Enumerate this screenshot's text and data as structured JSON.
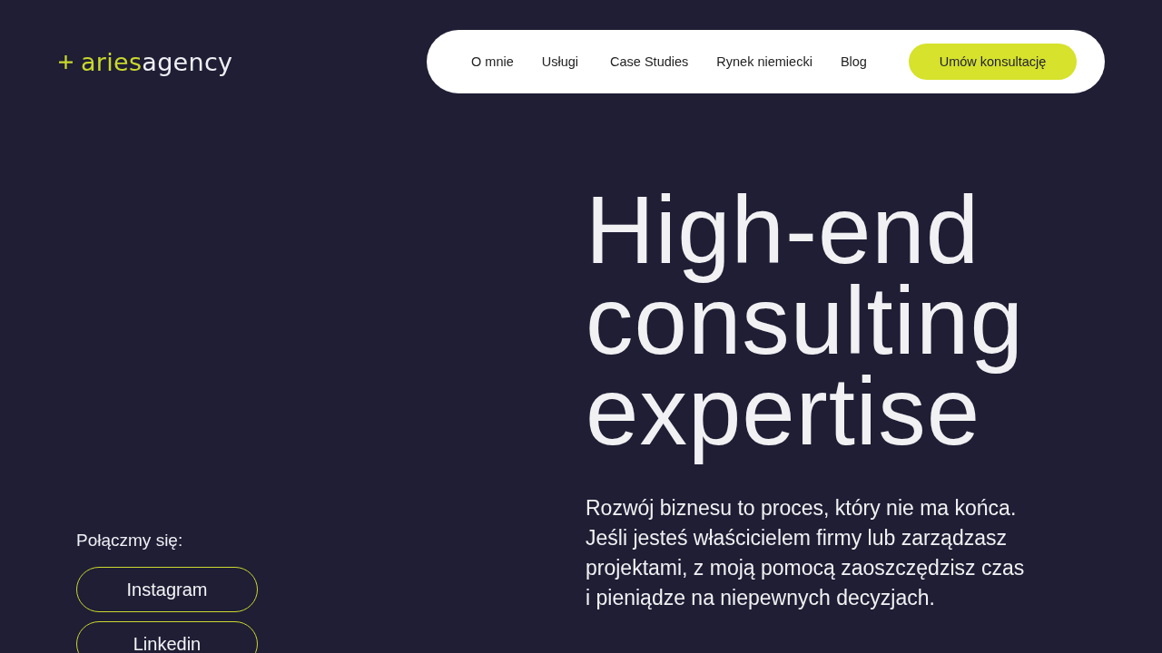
{
  "header": {
    "logo": {
      "primary": "aries",
      "secondary": "agency"
    },
    "nav": {
      "items": [
        "O mnie",
        "Usługi",
        "Case Studies",
        "Rynek niemiecki",
        "Blog"
      ],
      "cta": "Umów konsultację"
    }
  },
  "hero": {
    "heading": "High-end consulting expertise",
    "paragraph": "Rozwój biznesu to proces, który nie ma końca.\nJeśli jesteś właścicielem firmy lub zarządzasz\nprojektami, z moją pomocą zaoszczędzisz czas\ni pieniądze na niepewnych decyzjach."
  },
  "contact": {
    "label": "Połączmy się:",
    "links": [
      "Instagram",
      "Linkedin"
    ]
  }
}
